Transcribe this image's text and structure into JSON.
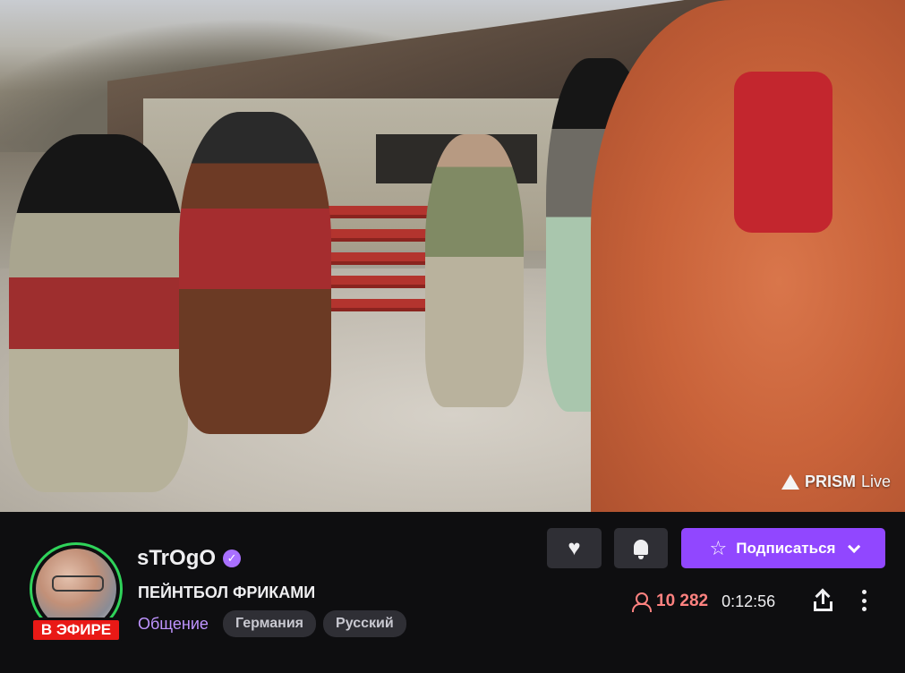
{
  "video": {
    "overlay_brand": "PRISM",
    "overlay_brand_suffix": "Live"
  },
  "channel": {
    "name": "sTrOgO",
    "verified_icon": "verified-badge-icon",
    "live_label": "В ЭФИРЕ",
    "stream_title": "ПЕЙНТБОЛ ФРИКАМИ",
    "category": "Общение",
    "tags": [
      "Германия",
      "Русский"
    ]
  },
  "actions": {
    "follow_icon": "heart-icon",
    "notifications_icon": "bell-icon",
    "subscribe_label": "Подписаться"
  },
  "stats": {
    "viewers": "10 282",
    "uptime": "0:12:56"
  },
  "colors": {
    "accent": "#9147ff",
    "live": "#e91916",
    "viewers": "#ff8280",
    "avatar_ring": "#2fd35a",
    "category": "#bf94ff"
  }
}
